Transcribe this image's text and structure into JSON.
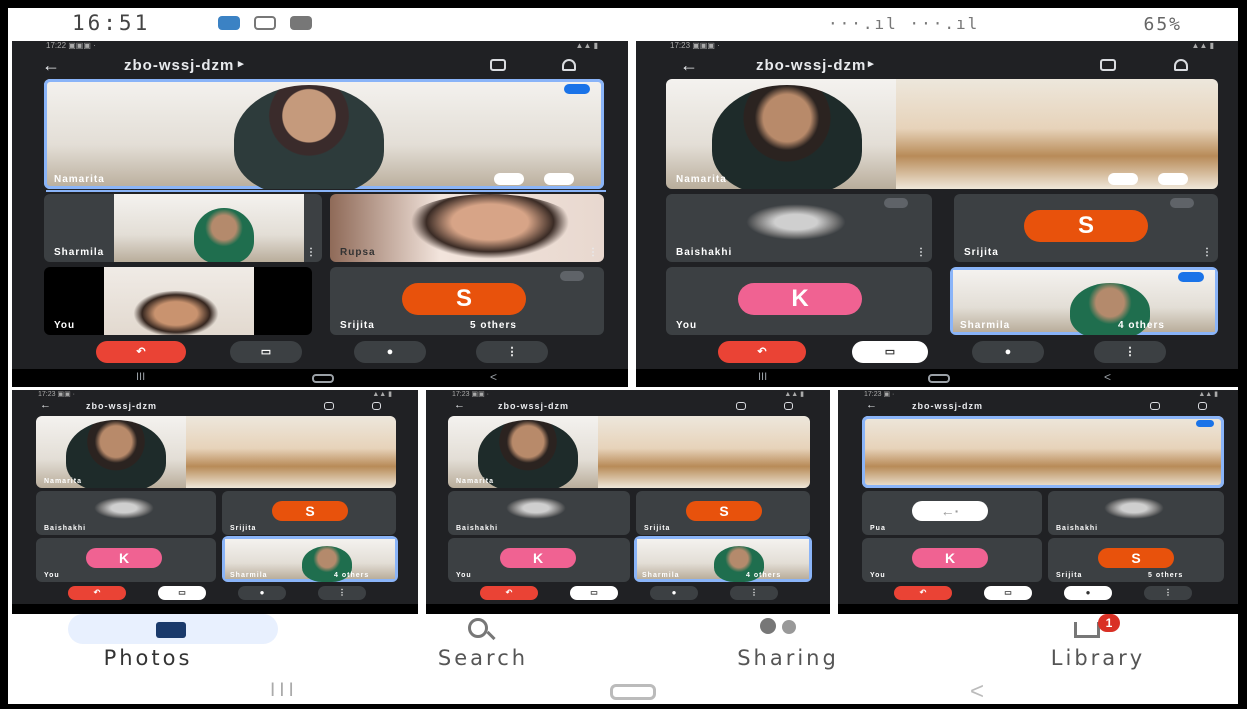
{
  "status_bar": {
    "time": "16:51",
    "right_text": "···.ıl ···.ıl",
    "battery": "65%"
  },
  "meeting": {
    "code": "zbo-wssj-dzm",
    "panels": [
      {
        "id": "panel-1",
        "main_tile_name": "Namarita",
        "tiles": [
          {
            "name": "Sharmila",
            "others": ""
          },
          {
            "name": "Rupsa",
            "others": ""
          },
          {
            "name": "You",
            "others": ""
          },
          {
            "name": "Srijita",
            "others": "5 others",
            "avatar": "S"
          }
        ]
      },
      {
        "id": "panel-2",
        "main_tile_name": "Namarita",
        "tiles": [
          {
            "name": "Baishakhi",
            "others": ""
          },
          {
            "name": "Srijita",
            "others": "",
            "avatar": "S"
          },
          {
            "name": "You",
            "others": "",
            "avatar": "K"
          },
          {
            "name": "Sharmila",
            "others": "4 others"
          }
        ]
      },
      {
        "id": "panel-3",
        "main_tile_name": "Namarita",
        "tiles": [
          {
            "name": "Baishakhi",
            "others": ""
          },
          {
            "name": "Srijita",
            "others": "",
            "avatar": "S"
          },
          {
            "name": "You",
            "others": "",
            "avatar": "K"
          },
          {
            "name": "Sharmila",
            "others": "4 others"
          }
        ]
      },
      {
        "id": "panel-4",
        "main_tile_name": "Namarita",
        "tiles": [
          {
            "name": "Baishakhi",
            "others": ""
          },
          {
            "name": "Srijita",
            "others": "",
            "avatar": "S"
          },
          {
            "name": "You",
            "others": "",
            "avatar": "K"
          },
          {
            "name": "Sharmila",
            "others": "4 others"
          }
        ]
      },
      {
        "id": "panel-5",
        "main_tile_name": "",
        "tiles": [
          {
            "name": "Pua",
            "others": ""
          },
          {
            "name": "Baishakhi",
            "others": ""
          },
          {
            "name": "You",
            "others": "",
            "avatar": "K"
          },
          {
            "name": "Srijita",
            "others": "5 others",
            "avatar": "S"
          }
        ]
      }
    ],
    "colors": {
      "end_call": "#ea4335",
      "avatar_s": "#e8520c",
      "avatar_k": "#f06292",
      "highlight": "#8ab4f8"
    }
  },
  "photos_nav": {
    "items": [
      {
        "label": "Photos",
        "icon": "photos-icon",
        "active": true
      },
      {
        "label": "Search",
        "icon": "search-icon",
        "active": false
      },
      {
        "label": "Sharing",
        "icon": "people-icon",
        "active": false
      },
      {
        "label": "Library",
        "icon": "library-icon",
        "active": false,
        "badge": "1"
      }
    ]
  },
  "system_nav": {
    "recent": "III",
    "home": "home-icon",
    "back": "<"
  }
}
